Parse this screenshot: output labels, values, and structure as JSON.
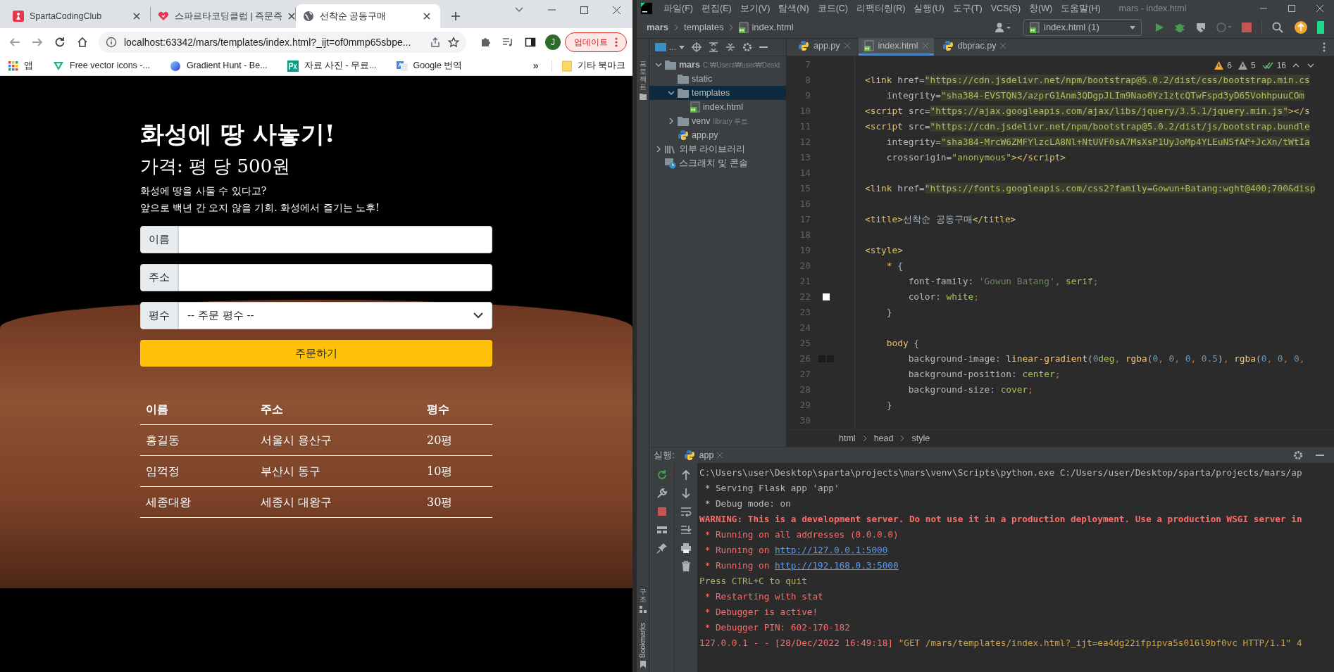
{
  "browser": {
    "tabs": [
      {
        "title": "SpartaCodingClub",
        "kind": "sparta",
        "selected": false
      },
      {
        "title": "스파르타코딩클럽 | 즉문즉",
        "kind": "heart",
        "selected": false
      },
      {
        "title": "선착순 공동구매",
        "kind": "globe",
        "selected": true
      }
    ],
    "address": "localhost:63342/mars/templates/index.html?_ijt=of0mmp65sbpe...",
    "profile": "J",
    "update_button": "업데이트",
    "bookmarks": [
      {
        "label": "앱",
        "kind": "apps"
      },
      {
        "label": "Free vector icons -...",
        "kind": "vector"
      },
      {
        "label": "Gradient Hunt - Be...",
        "kind": "gradient"
      },
      {
        "label": "자료 사진 - 무료...",
        "kind": "px"
      },
      {
        "label": "Google 번역",
        "kind": "translate"
      }
    ],
    "more": "»",
    "other_bookmarks": "기타 북마크"
  },
  "page": {
    "title": "화성에 땅 사놓기!",
    "price": "가격: 평 당 500원",
    "intro": [
      "화성에 땅을 사둘 수 있다고?",
      "앞으로 백년 간 오지 않을 기회. 화성에서 즐기는 노후!"
    ],
    "fields": [
      {
        "label": "이름",
        "kind": "text"
      },
      {
        "label": "주소",
        "kind": "text"
      },
      {
        "label": "평수",
        "kind": "select",
        "value": "-- 주문 평수 --"
      }
    ],
    "submit": "주문하기",
    "table": {
      "columns": [
        "이름",
        "주소",
        "평수"
      ],
      "rows": [
        [
          "홍길동",
          "서울시 용산구",
          "20평"
        ],
        [
          "임꺽정",
          "부산시 동구",
          "10평"
        ],
        [
          "세종대왕",
          "세종시 대왕구",
          "30평"
        ]
      ]
    }
  },
  "ide": {
    "menus": [
      "파일(F)",
      "편집(E)",
      "보기(V)",
      "탐색(N)",
      "코드(C)",
      "리팩터링(R)",
      "실행(U)",
      "도구(T)",
      "VCS(S)",
      "창(W)",
      "도움말(H)"
    ],
    "window_title": "mars - index.html",
    "breadcrumb": [
      "mars",
      "templates",
      "index.html"
    ],
    "run_config": "index.html (1)",
    "view_label": "...",
    "file_tabs": [
      {
        "label": "app.py",
        "kind": "py",
        "selected": false
      },
      {
        "label": "index.html",
        "kind": "html",
        "selected": true
      },
      {
        "label": "dbprac.py",
        "kind": "py",
        "selected": false
      }
    ],
    "inspections": [
      {
        "kind": "warning",
        "count": "6"
      },
      {
        "kind": "weak",
        "count": "5"
      },
      {
        "kind": "typo",
        "count": "16"
      }
    ],
    "side_labels": {
      "project": "프로젝트",
      "structure": "구조",
      "bookmarks": "Bookmarks"
    },
    "tree": [
      {
        "label": "mars",
        "hint": "C:₩Users₩user₩Deskt",
        "kind": "folder",
        "expanded": true,
        "selected": false,
        "children": [
          {
            "label": "static",
            "kind": "folder",
            "selected": false
          },
          {
            "label": "templates",
            "kind": "folder",
            "expanded": true,
            "selected": true,
            "children": [
              {
                "label": "index.html",
                "kind": "html",
                "selected": false
              }
            ]
          },
          {
            "label": "venv",
            "hint": "library 루트",
            "kind": "folder",
            "expanded": false,
            "selected": false
          },
          {
            "label": "app.py",
            "kind": "py",
            "selected": false
          }
        ]
      },
      {
        "label": "외부 라이브러리",
        "kind": "library",
        "expanded": false,
        "selected": false
      },
      {
        "label": "스크래치 및 콘솔",
        "kind": "scratch",
        "selected": false
      }
    ],
    "code": [
      {
        "n": "7"
      },
      {
        "n": "8",
        "tokens": [
          {
            "kind": "tag",
            "text": "<link "
          },
          {
            "kind": "attr",
            "text": "href="
          },
          {
            "kind": "url",
            "text": "\"https://cdn.jsdelivr.net/npm/bootstrap@5.0.2/dist/css/bootstrap.min.cs"
          }
        ]
      },
      {
        "n": "9",
        "tokens": [
          {
            "kind": "attr",
            "text": "    integrity="
          },
          {
            "kind": "url",
            "text": "\"sha384-EVSTQN3/azprG1Anm3QDgpJLIm9Nao0Yz1ztcQTwFspd3yD65VohhpuuCOm"
          }
        ]
      },
      {
        "n": "10",
        "tokens": [
          {
            "kind": "tag",
            "text": "<script "
          },
          {
            "kind": "attr",
            "text": "src="
          },
          {
            "kind": "url",
            "text": "\"https://ajax.googleapis.com/ajax/libs/jquery/3.5.1/jquery.min.js\""
          },
          {
            "kind": "tag",
            "text": "></s"
          }
        ]
      },
      {
        "n": "11",
        "tokens": [
          {
            "kind": "tag",
            "text": "<script "
          },
          {
            "kind": "attr",
            "text": "src="
          },
          {
            "kind": "url",
            "text": "\"https://cdn.jsdelivr.net/npm/bootstrap@5.0.2/dist/js/bootstrap.bundle"
          }
        ]
      },
      {
        "n": "12",
        "tokens": [
          {
            "kind": "attr",
            "text": "    integrity="
          },
          {
            "kind": "url",
            "text": "\"sha384-MrcW6ZMFYlzcLA8Nl+NtUVF0sA7MsXsP1UyJoMp4YLEuNSfAP+JcXn/tWtIa"
          }
        ]
      },
      {
        "n": "13",
        "tokens": [
          {
            "kind": "attr",
            "text": "    crossorigin="
          },
          {
            "kind": "str",
            "text": "\"anonymous\""
          },
          {
            "kind": "tag",
            "text": "></script>"
          }
        ]
      },
      {
        "n": "14"
      },
      {
        "n": "15",
        "tokens": [
          {
            "kind": "tag",
            "text": "<link "
          },
          {
            "kind": "attr",
            "text": "href="
          },
          {
            "kind": "url",
            "text": "\"https://fonts.googleapis.com/css2?family=Gowun+Batang:wght@400;700&disp"
          }
        ]
      },
      {
        "n": "16"
      },
      {
        "n": "17",
        "tokens": [
          {
            "kind": "tag",
            "text": "<title>"
          },
          {
            "kind": "text",
            "text": "선착순 공동구매"
          },
          {
            "kind": "tag",
            "text": "</title>"
          }
        ]
      },
      {
        "n": "18"
      },
      {
        "n": "19",
        "tokens": [
          {
            "kind": "tag",
            "text": "<style>"
          }
        ]
      },
      {
        "n": "20",
        "tokens": [
          {
            "kind": "sel",
            "text": "    * "
          },
          {
            "kind": "text",
            "text": "{"
          }
        ]
      },
      {
        "n": "21",
        "tokens": [
          {
            "kind": "prop",
            "text": "        font-family"
          },
          {
            "kind": "text",
            "text": ": "
          },
          {
            "kind": "cssstr",
            "text": "'Gowun Batang'"
          },
          {
            "kind": "punc",
            "text": ", "
          },
          {
            "kind": "val",
            "text": "serif"
          },
          {
            "kind": "punc",
            "text": ";"
          }
        ]
      },
      {
        "n": "22",
        "swatches": [
          {
            "color": "#ffffff"
          }
        ],
        "tokens": [
          {
            "kind": "prop",
            "text": "        color"
          },
          {
            "kind": "text",
            "text": ": "
          },
          {
            "kind": "val",
            "text": "white"
          },
          {
            "kind": "punc",
            "text": ";"
          }
        ]
      },
      {
        "n": "23",
        "tokens": [
          {
            "kind": "text",
            "text": "    }"
          }
        ]
      },
      {
        "n": "24"
      },
      {
        "n": "25",
        "tokens": [
          {
            "kind": "sel",
            "text": "    body "
          },
          {
            "kind": "text",
            "text": "{"
          }
        ]
      },
      {
        "n": "26",
        "swatches": [
          {
            "color": "#1c1c1c"
          },
          {
            "color": "#1c1c1c"
          }
        ],
        "tokens": [
          {
            "kind": "prop",
            "text": "        background-image"
          },
          {
            "kind": "text",
            "text": ": "
          },
          {
            "kind": "fn",
            "text": "linear-gradient"
          },
          {
            "kind": "text",
            "text": "("
          },
          {
            "kind": "num",
            "text": "0"
          },
          {
            "kind": "val",
            "text": "deg"
          },
          {
            "kind": "punc",
            "text": ", "
          },
          {
            "kind": "fn",
            "text": "rgba"
          },
          {
            "kind": "text",
            "text": "("
          },
          {
            "kind": "num",
            "text": "0"
          },
          {
            "kind": "punc",
            "text": ", "
          },
          {
            "kind": "num",
            "text": "0"
          },
          {
            "kind": "punc",
            "text": ", "
          },
          {
            "kind": "num",
            "text": "0"
          },
          {
            "kind": "punc",
            "text": ", "
          },
          {
            "kind": "num",
            "text": "0.5"
          },
          {
            "kind": "text",
            "text": ")"
          },
          {
            "kind": "punc",
            "text": ", "
          },
          {
            "kind": "fn",
            "text": "rgba"
          },
          {
            "kind": "text",
            "text": "("
          },
          {
            "kind": "num",
            "text": "0"
          },
          {
            "kind": "punc",
            "text": ", "
          },
          {
            "kind": "num",
            "text": "0"
          },
          {
            "kind": "punc",
            "text": ", "
          },
          {
            "kind": "num",
            "text": "0"
          },
          {
            "kind": "punc",
            "text": ", "
          }
        ]
      },
      {
        "n": "27",
        "tokens": [
          {
            "kind": "prop",
            "text": "        background-position"
          },
          {
            "kind": "text",
            "text": ": "
          },
          {
            "kind": "val",
            "text": "center"
          },
          {
            "kind": "punc",
            "text": ";"
          }
        ]
      },
      {
        "n": "28",
        "tokens": [
          {
            "kind": "prop",
            "text": "        background-size"
          },
          {
            "kind": "text",
            "text": ": "
          },
          {
            "kind": "val",
            "text": "cover"
          },
          {
            "kind": "punc",
            "text": ";"
          }
        ]
      },
      {
        "n": "29",
        "tokens": [
          {
            "kind": "text",
            "text": "    }"
          }
        ]
      },
      {
        "n": "30"
      }
    ],
    "editor_breadcrumb": [
      "html",
      "head",
      "style"
    ],
    "run": {
      "label": "실행:",
      "tab": "app",
      "lines": [
        [
          {
            "kind": "out",
            "text": "C:\\Users\\user\\Desktop\\sparta\\projects\\mars\\venv\\Scripts\\python.exe C:/Users/user/Desktop/sparta/projects/mars/ap"
          }
        ],
        [
          {
            "kind": "out",
            "text": " * Serving Flask app 'app'"
          }
        ],
        [
          {
            "kind": "out",
            "text": " * Debug mode: on"
          }
        ],
        [
          {
            "kind": "warn",
            "text": "WARNING: This is a development server. Do not use it in a production deployment. Use a production WSGI server in"
          }
        ],
        [
          {
            "kind": "err",
            "text": " * Running on all addresses (0.0.0.0)"
          }
        ],
        [
          {
            "kind": "err",
            "text": " * Running on "
          },
          {
            "kind": "link",
            "text": "http://127.0.0.1:5000"
          }
        ],
        [
          {
            "kind": "err",
            "text": " * Running on "
          },
          {
            "kind": "link",
            "text": "http://192.168.0.3:5000"
          }
        ],
        [
          {
            "kind": "info",
            "text": "Press CTRL+C to quit"
          }
        ],
        [
          {
            "kind": "err",
            "text": " * Restarting with stat"
          }
        ],
        [
          {
            "kind": "err",
            "text": " * Debugger is active!"
          }
        ],
        [
          {
            "kind": "err",
            "text": " * Debugger PIN: 602-170-182"
          }
        ],
        [
          {
            "kind": "err",
            "text": "127.0.0.1 - - [28/Dec/2022 16:49:18] "
          },
          {
            "kind": "req",
            "text": "\"GET /mars/templates/index.html?_ijt=ea4dg22ifpipva5s016l9bf0vc HTTP/1.1\" 4"
          }
        ]
      ]
    }
  }
}
